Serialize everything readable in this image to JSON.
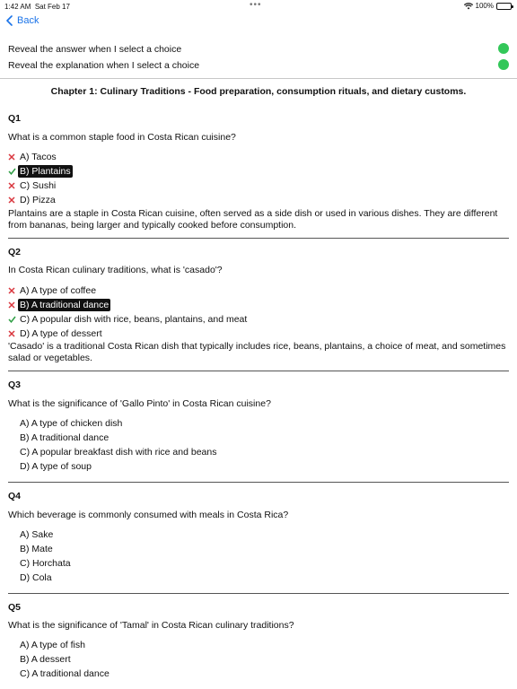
{
  "status": {
    "time": "1:42 AM",
    "date": "Sat Feb 17",
    "battery": "100%"
  },
  "nav": {
    "back_label": "Back"
  },
  "settings": {
    "reveal_answer": "Reveal the answer when I select a choice",
    "reveal_explanation": "Reveal the explanation when I select a choice",
    "toggle_color": "#33c759"
  },
  "chapter_title": "Chapter 1: Culinary Traditions - Food preparation, consumption rituals, and dietary customs.",
  "questions": [
    {
      "label": "Q1",
      "text": "What is a common staple food in Costa Rican cuisine?",
      "options": [
        {
          "text": "A) Tacos",
          "mark": "wrong",
          "selected": false
        },
        {
          "text": "B) Plantains",
          "mark": "correct",
          "selected": true
        },
        {
          "text": "C) Sushi",
          "mark": "wrong",
          "selected": false
        },
        {
          "text": "D) Pizza",
          "mark": "wrong",
          "selected": false
        }
      ],
      "explanation": "Plantains are a staple in Costa Rican cuisine, often served as a side dish or used in various dishes. They are different from bananas, being larger and typically cooked before consumption."
    },
    {
      "label": "Q2",
      "text": "In Costa Rican culinary traditions, what is 'casado'?",
      "options": [
        {
          "text": "A) A type of coffee",
          "mark": "wrong",
          "selected": false
        },
        {
          "text": "B) A traditional dance",
          "mark": "wrong",
          "selected": true
        },
        {
          "text": "C) A popular dish with rice, beans, plantains, and meat",
          "mark": "correct",
          "selected": false
        },
        {
          "text": "D) A type of dessert",
          "mark": "wrong",
          "selected": false
        }
      ],
      "explanation": "'Casado' is a traditional Costa Rican dish that typically includes rice, beans, plantains, a choice of meat, and sometimes salad or vegetables."
    },
    {
      "label": "Q3",
      "text": "What is the significance of 'Gallo Pinto' in Costa Rican cuisine?",
      "options": [
        {
          "text": "A) A type of chicken dish",
          "mark": "none",
          "selected": false
        },
        {
          "text": "B) A traditional dance",
          "mark": "none",
          "selected": false
        },
        {
          "text": "C) A popular breakfast dish with rice and beans",
          "mark": "none",
          "selected": false
        },
        {
          "text": "D) A type of soup",
          "mark": "none",
          "selected": false
        }
      ]
    },
    {
      "label": "Q4",
      "text": "Which beverage is commonly consumed with meals in Costa Rica?",
      "options": [
        {
          "text": "A) Sake",
          "mark": "none",
          "selected": false
        },
        {
          "text": "B) Mate",
          "mark": "none",
          "selected": false
        },
        {
          "text": "C) Horchata",
          "mark": "none",
          "selected": false
        },
        {
          "text": "D) Cola",
          "mark": "none",
          "selected": false
        }
      ]
    },
    {
      "label": "Q5",
      "text": "What is the significance of 'Tamal' in Costa Rican culinary traditions?",
      "options": [
        {
          "text": "A) A type of fish",
          "mark": "none",
          "selected": false
        },
        {
          "text": "B) A dessert",
          "mark": "none",
          "selected": false
        },
        {
          "text": "C) A traditional dance",
          "mark": "none",
          "selected": false
        }
      ]
    }
  ],
  "colors": {
    "accent": "#1a73e8",
    "wrong": "#d9363e",
    "correct": "#2e9e44"
  }
}
